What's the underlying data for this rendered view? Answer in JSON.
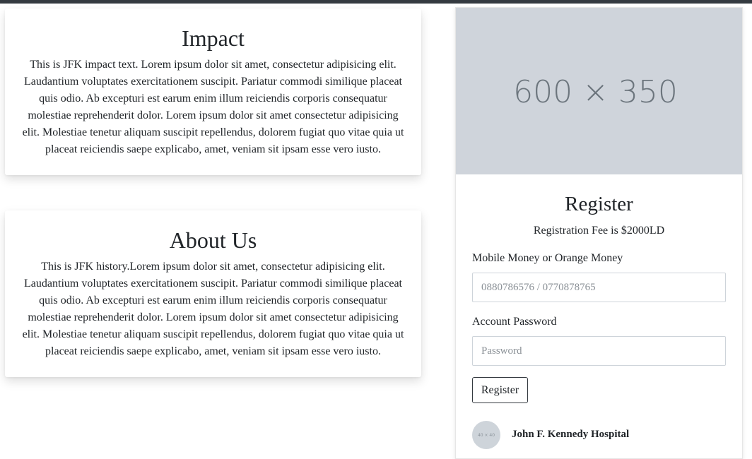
{
  "impact": {
    "title": "Impact",
    "text": "This is JFK impact text. Lorem ipsum dolor sit amet, consectetur adipisicing elit. Laudantium voluptates exercitationem suscipit. Pariatur commodi similique placeat quis odio. Ab excepturi est earum enim illum reiciendis corporis consequatur molestiae reprehenderit dolor. Lorem ipsum dolor sit amet consectetur adipisicing elit. Molestiae tenetur aliquam suscipit repellendus, dolorem fugiat quo vitae quia ut placeat reiciendis saepe explicabo, amet, veniam sit ipsam esse vero iusto."
  },
  "about": {
    "title": "About Us",
    "text": "This is JFK history.Lorem ipsum dolor sit amet, consectetur adipisicing elit. Laudantium voluptates exercitationem suscipit. Pariatur commodi similique placeat quis odio. Ab excepturi est earum enim illum reiciendis corporis consequatur molestiae reprehenderit dolor. Lorem ipsum dolor sit amet consectetur adipisicing elit. Molestiae tenetur aliquam suscipit repellendus, dolorem fugiat quo vitae quia ut placeat reiciendis saepe explicabo, amet, veniam sit ipsam esse vero iusto."
  },
  "register": {
    "image_placeholder": "600 × 350",
    "title": "Register",
    "fee": "Registration Fee is $2000LD",
    "mobile_label": "Mobile Money or Orange Money",
    "mobile_placeholder": "0880786576 / 0770878765",
    "password_label": "Account Password",
    "password_placeholder": "Password",
    "button_label": "Register",
    "avatar_placeholder": "40 × 40",
    "hospital_name": "John F. Kennedy Hospital"
  },
  "colors": {
    "topbar": "#343a40",
    "image_bg": "#cfd4db"
  }
}
